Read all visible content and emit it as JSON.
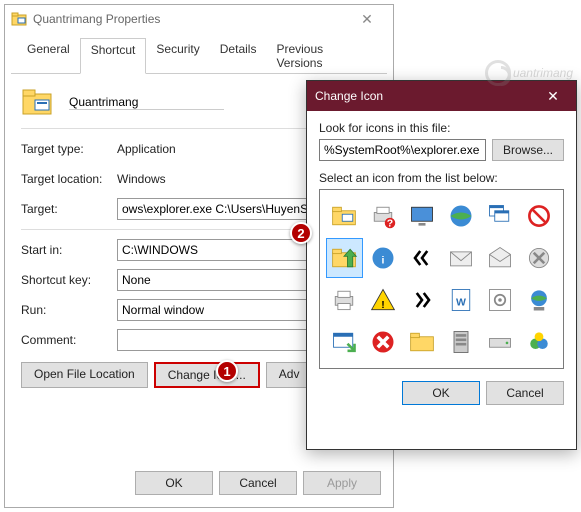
{
  "props": {
    "title": "Quantrimang Properties",
    "tabs": [
      "General",
      "Shortcut",
      "Security",
      "Details",
      "Previous Versions"
    ],
    "active_tab": "Shortcut",
    "name": "Quantrimang",
    "target_type_label": "Target type:",
    "target_type_value": "Application",
    "target_location_label": "Target location:",
    "target_location_value": "Windows",
    "target_label": "Target:",
    "target_value": "ows\\explorer.exe C:\\Users\\HuyenSP\\",
    "start_in_label": "Start in:",
    "start_in_value": "C:\\WINDOWS",
    "shortcut_key_label": "Shortcut key:",
    "shortcut_key_value": "None",
    "run_label": "Run:",
    "run_value": "Normal window",
    "comment_label": "Comment:",
    "comment_value": "",
    "open_file_location": "Open File Location",
    "change_icon": "Change Icon...",
    "advanced": "Adv",
    "ok": "OK",
    "cancel": "Cancel",
    "apply": "Apply"
  },
  "ci": {
    "title": "Change Icon",
    "look_label": "Look for icons in this file:",
    "path": "%SystemRoot%\\explorer.exe",
    "browse": "Browse...",
    "select_label": "Select an icon from the list below:",
    "ok": "OK",
    "cancel": "Cancel",
    "icons": [
      "folder-icon",
      "printer-question-icon",
      "monitor-icon",
      "globe-icon",
      "windows-cascade-icon",
      "no-entry-icon",
      "folder-up-icon",
      "info-icon",
      "chevrons-left-icon",
      "envelope-icon",
      "envelope-open-icon",
      "cancel-circle-icon",
      "printer-icon",
      "warning-icon",
      "chevrons-right-icon",
      "word-icon",
      "gear-box-icon",
      "network-globe-icon",
      "window-arrow-icon",
      "error-icon",
      "folder-yellow-icon",
      "server-icon",
      "drive-icon",
      "msn-icon"
    ],
    "selected_index": 6
  },
  "annotations": {
    "b1": "1",
    "b2": "2"
  },
  "watermark": "uantrimang"
}
